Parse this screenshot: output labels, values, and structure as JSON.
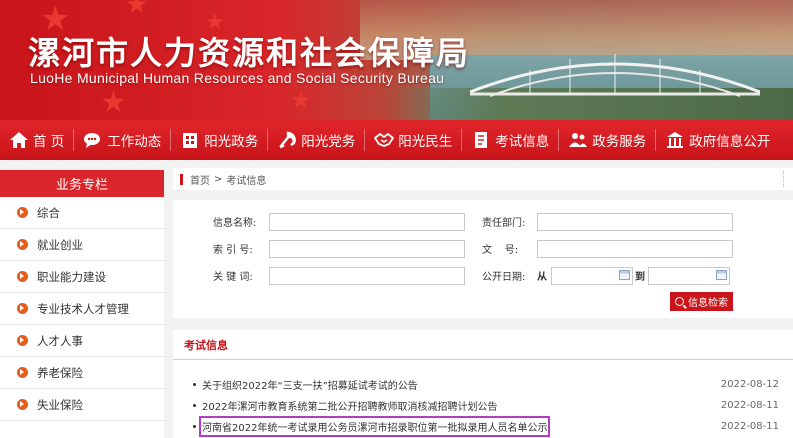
{
  "header": {
    "title_cn": "漯河市人力资源和社会保障局",
    "title_en": "LuoHe Municipal Human Resources and Social Security Bureau"
  },
  "nav": [
    {
      "label": "首 页",
      "icon": "home-icon"
    },
    {
      "label": "工作动态",
      "icon": "chat-bubble-icon"
    },
    {
      "label": "阳光政务",
      "icon": "building-icon"
    },
    {
      "label": "阳光党务",
      "icon": "party-emblem-icon"
    },
    {
      "label": "阳光民生",
      "icon": "handshake-icon"
    },
    {
      "label": "考试信息",
      "icon": "document-icon"
    },
    {
      "label": "政务服务",
      "icon": "people-icon"
    },
    {
      "label": "政府信息公开",
      "icon": "government-building-icon"
    }
  ],
  "sidebar": {
    "title": "业务专栏",
    "items": [
      "综合",
      "就业创业",
      "职业能力建设",
      "专业技术人才管理",
      "人才人事",
      "养老保险",
      "失业保险"
    ]
  },
  "breadcrumb": {
    "home": "首页",
    "sep": ">",
    "current": "考试信息"
  },
  "search": {
    "name_label": "信息名称:",
    "dept_label": "责任部门:",
    "index_label": "索 引 号:",
    "doc_label": "文    号:",
    "keyword_label": "关 键 词:",
    "date_label": "公开日期:",
    "from_label": "从",
    "to_label": "到",
    "button_label": "信息检索",
    "name_value": "",
    "dept_value": "",
    "index_value": "",
    "doc_value": "",
    "keyword_value": "",
    "date_from": "",
    "date_to": ""
  },
  "exam": {
    "title": "考试信息",
    "items": [
      {
        "title": "关于组织2022年“三支一扶”招募延试考试的公告",
        "date": "2022-08-12"
      },
      {
        "title": "2022年漯河市教育系统第二批公开招聘教师取消核减招聘计划公告",
        "date": "2022-08-11"
      },
      {
        "title": "河南省2022年统一考试录用公务员漯河市招录职位第一批拟录用人员名单公示",
        "date": "2022-08-11",
        "highlighted": true
      }
    ]
  },
  "colors": {
    "brand_red": "#c8141a",
    "accent_orange": "#e85a1e",
    "highlight_purple": "#b43bc4"
  }
}
